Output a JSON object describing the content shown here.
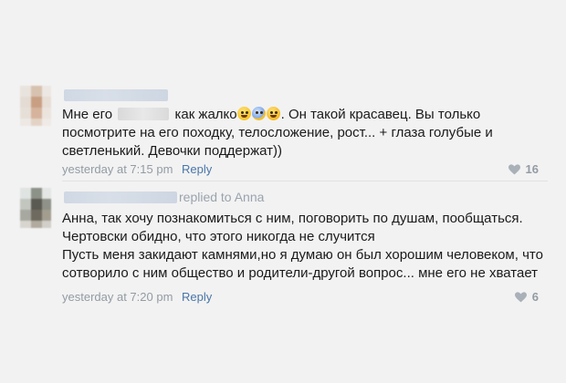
{
  "comments": [
    {
      "text_before_blur": "Мне его",
      "text_after_blur": "как жалко",
      "text_after_emoji": ". Он такой красавец. Вы только",
      "lines": [
        "посмотрите на его походку, телосложение, рост... + глаза голубые и",
        "светленький. Девочки поддержат))"
      ],
      "emoji": [
        "grinning-sweat-emoji",
        "fearful-emoji",
        "crying-emoji"
      ],
      "time": "yesterday at 7:15 pm",
      "reply_label": "Reply",
      "likes": "16"
    },
    {
      "replied_to": "replied to Anna",
      "lines": [
        "Анна, так хочу познакомиться с ним, поговорить по душам, пообщаться.",
        "Чертовски обидно, что этого никогда не случится",
        "Пусть меня закидают камнями,но я думаю он был хорошим человеком, что",
        "сотворило с ним общество и родители-другой вопрос... мне его не хватает"
      ],
      "time": "yesterday at 7:20 pm",
      "reply_label": "Reply",
      "likes": "6"
    }
  ],
  "colors": {
    "background": "#f2f2f2",
    "link": "#4a76a8",
    "meta": "#939ba4",
    "text": "#1a1a1a"
  }
}
